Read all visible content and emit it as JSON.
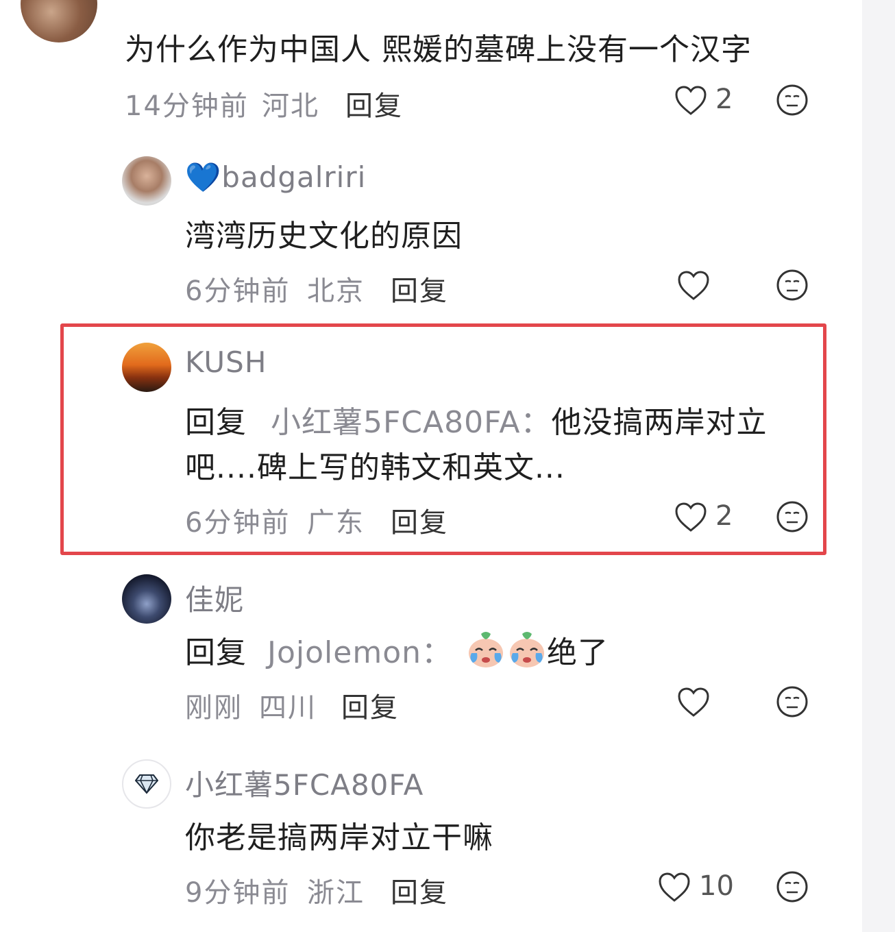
{
  "comments": [
    {
      "body": "为什么作为中国人 熙媛的墓碑上没有一个汉字",
      "meta": {
        "time": "14分钟前",
        "region": "河北"
      },
      "reply_label": "回复",
      "likes": "2"
    },
    {
      "username": "💙badgalriri",
      "body": "湾湾历史文化的原因",
      "meta": {
        "time": "6分钟前",
        "region": "北京"
      },
      "reply_label": "回复",
      "likes": ""
    },
    {
      "username": "KUSH",
      "reply_prefix": "回复",
      "reply_target": "小红薯5FCA80FA：",
      "body_line1": "他没搞两岸对立",
      "body_line2": "吧....碑上写的韩文和英文...",
      "meta": {
        "time": "6分钟前",
        "region": "广东"
      },
      "reply_label": "回复",
      "likes": "2",
      "highlighted": true
    },
    {
      "username": "佳妮",
      "reply_prefix": "回复",
      "reply_target": "Jojolemon：",
      "body_suffix": "绝了",
      "emojis": [
        "crying-face-icon",
        "crying-face-icon"
      ],
      "meta": {
        "time": "刚刚",
        "region": "四川"
      },
      "reply_label": "回复",
      "likes": ""
    },
    {
      "username": "小红薯5FCA80FA",
      "body": "你老是搞两岸对立干嘛",
      "meta": {
        "time": "9分钟前",
        "region": "浙江"
      },
      "reply_label": "回复",
      "likes": "10"
    }
  ],
  "colors": {
    "highlight_border": "#e3464b",
    "meta_text": "#8a8a92",
    "name_text": "#7e7e86"
  },
  "icons": {
    "like": "heart-outline-icon",
    "dislike": "neutral-face-icon"
  }
}
